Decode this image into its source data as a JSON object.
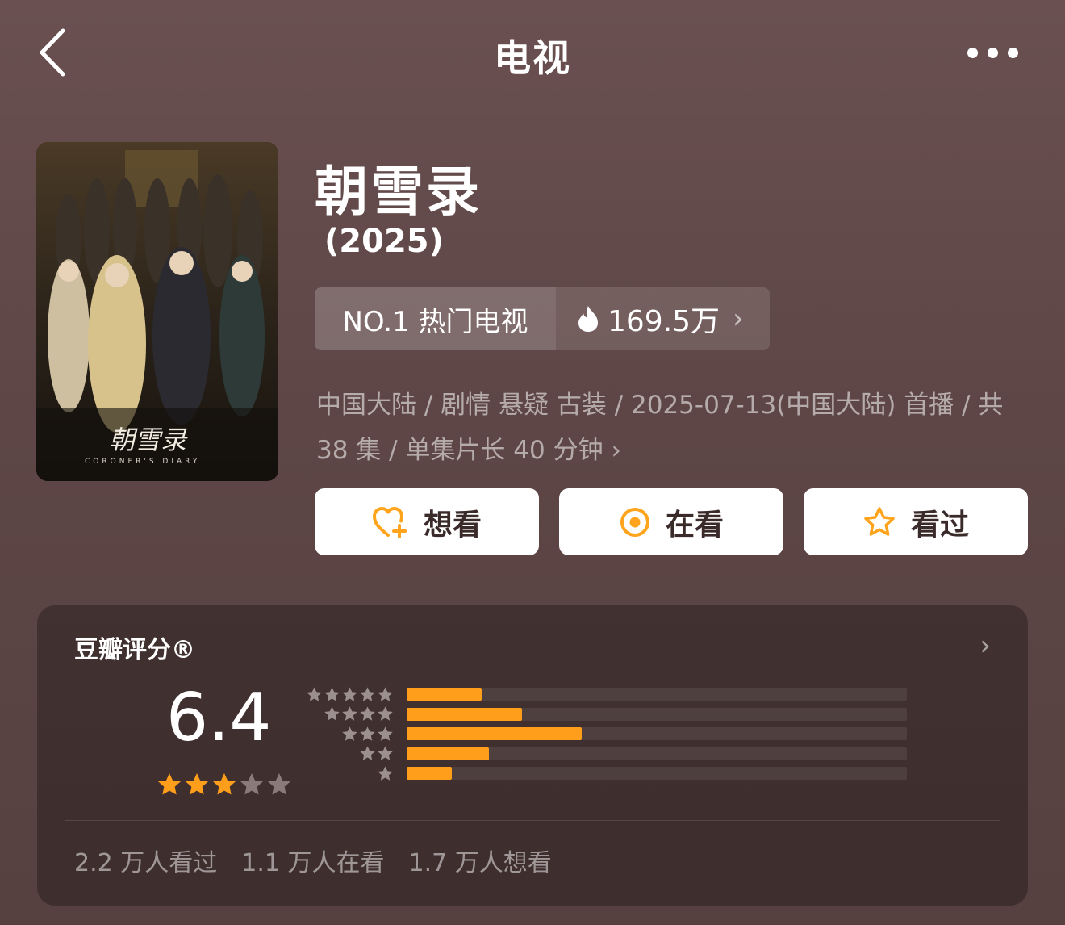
{
  "header": {
    "title": "电视"
  },
  "show": {
    "title": "朝雪录",
    "year": "(2025)",
    "rank_label": "NO.1 热门电视",
    "heat_value": "169.5万",
    "meta_line1": "中国大陆 / 剧情 悬疑 古装 / 2025-07-13(中国大陆) 首播 / 共",
    "meta_line2": "38 集 / 单集片长 40 分钟",
    "poster_title": "朝雪录",
    "poster_subtitle": "CORONER'S DIARY"
  },
  "actions": [
    {
      "label": "想看",
      "icon": "heart-plus-icon"
    },
    {
      "label": "在看",
      "icon": "target-circle-icon"
    },
    {
      "label": "看过",
      "icon": "star-outline-icon"
    }
  ],
  "rating": {
    "title": "豆瓣评分®",
    "score": "6.4",
    "stars_filled": 3,
    "stars_total": 5,
    "distribution": [
      {
        "stars": 5,
        "fraction": 0.15
      },
      {
        "stars": 4,
        "fraction": 0.23
      },
      {
        "stars": 3,
        "fraction": 0.35
      },
      {
        "stars": 2,
        "fraction": 0.165
      },
      {
        "stars": 1,
        "fraction": 0.09
      }
    ],
    "counts": [
      "2.2 万人看过",
      "1.1 万人在看",
      "1.7 万人想看"
    ]
  },
  "colors": {
    "accent": "#ff9e1b",
    "background": "#5e4646"
  }
}
